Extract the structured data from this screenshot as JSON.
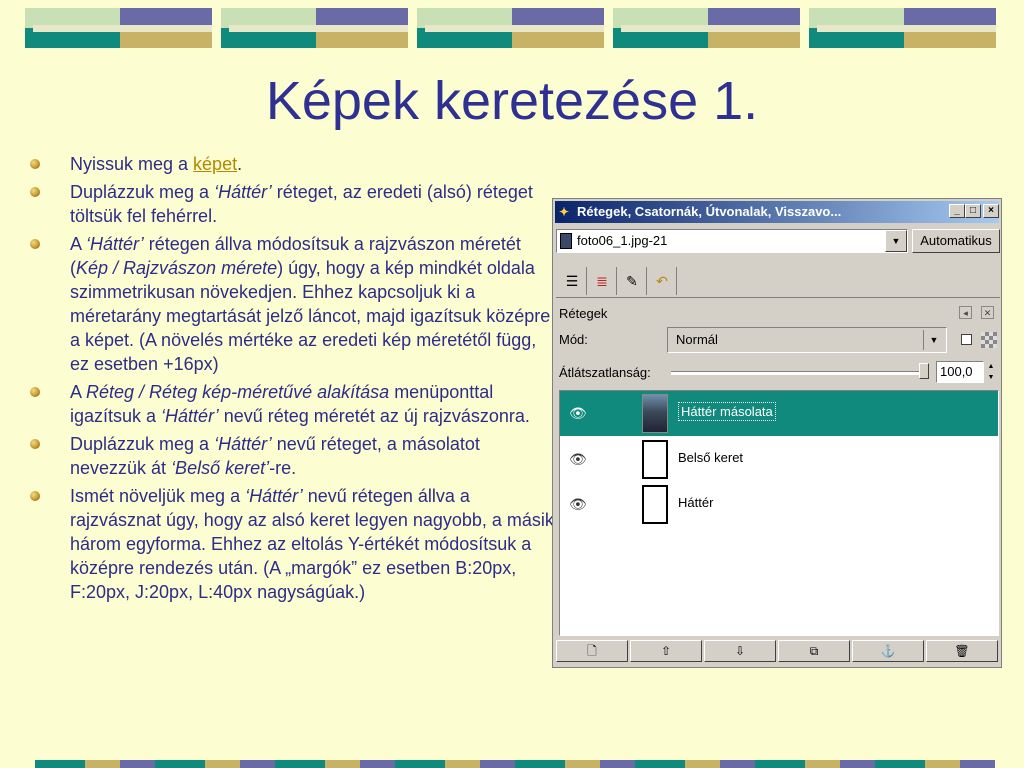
{
  "slide": {
    "title": "Képek keretezése 1."
  },
  "bullets": {
    "b1": {
      "pre": "Nyissuk meg a ",
      "link": "képet",
      "post": "."
    },
    "b2": {
      "pre": "Duplázzuk meg a ",
      "em": "‘Háttér’",
      "post": " réteget, az eredeti (alsó) réteget töltsük fel fehérrel."
    },
    "b3": {
      "pre": "A ",
      "em1": "‘Háttér’",
      "mid": " rétegen állva módosítsuk a rajzvászon méretét (",
      "em2": "Kép / Rajzvászon mérete",
      "post": ") úgy, hogy a kép mindkét oldala szimmetrikusan növekedjen. Ehhez kapcsoljuk ki a méretarány megtartását jelző láncot, majd igazítsuk középre a képet. (A növelés mértéke az eredeti kép méretétől függ, ez esetben +16px)"
    },
    "b4": {
      "pre": "A ",
      "em1": "Réteg / Réteg kép-méretűvé alakítása",
      "mid": " menüponttal igazítsuk a ",
      "em2": "‘Háttér’",
      "post": " nevű réteg méretét az új rajzvászonra."
    },
    "b5": {
      "pre": "Duplázzuk meg a ",
      "em1": "‘Háttér’",
      "mid": " nevű réteget, a másolatot nevezzük át ",
      "em2": "‘Belső keret’",
      "post": "-re."
    },
    "b6": {
      "pre": "Ismét növeljük meg a ",
      "em": "‘Háttér’",
      "post": " nevű rétegen állva a rajzvásznat úgy, hogy az alsó keret legyen nagyobb, a másik három egyforma. Ehhez az eltolás Y-értékét módosítsuk a középre rendezés után. (A „margók” ez esetben B:20px, F:20px, J:20px, L:40px nagyságúak.)"
    }
  },
  "dialog": {
    "title": "Rétegek, Csatornák, Útvonalak, Visszavo...",
    "minimize": "_",
    "maximize": "□",
    "close": "×",
    "image_select_value": "foto06_1.jpg-21",
    "auto_button": "Automatikus",
    "panel_label": "Rétegek",
    "mode_label": "Mód:",
    "mode_value": "Normál",
    "opacity_label": "Átlátszatlanság:",
    "opacity_value": "100,0",
    "layers": [
      {
        "name": "Háttér másolata",
        "selected": true
      },
      {
        "name": "Belső keret",
        "selected": false
      },
      {
        "name": "Háttér",
        "selected": false
      }
    ],
    "bottom_buttons": [
      "🗋",
      "⇧",
      "⇩",
      "⧉",
      "⚓",
      "🗑"
    ],
    "tab_icons": [
      "layers-tab-icon",
      "channels-tab-icon",
      "paths-tab-icon",
      "undo-tab-icon"
    ]
  },
  "colors": {
    "background": "#fdfdd2",
    "title": "#2e3192",
    "text": "#2d2d88",
    "link": "#b08a00",
    "selection": "#118a7e"
  }
}
